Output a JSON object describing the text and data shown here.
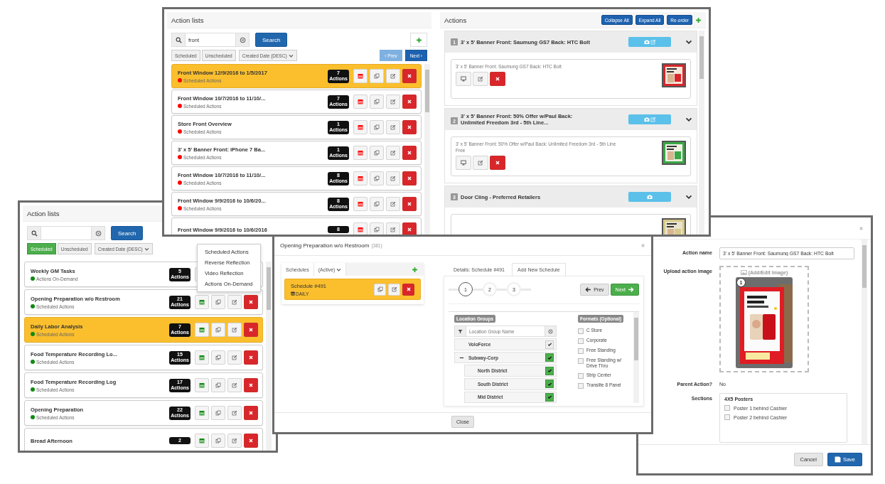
{
  "top_window": {
    "action_lists": {
      "title": "Action lists",
      "search": {
        "value": "front"
      },
      "search_button": "Search",
      "filters": [
        {
          "label": "Scheduled",
          "selected": false
        },
        {
          "label": "Unscheduled",
          "selected": false
        }
      ],
      "sort": "Created Date (DESC)",
      "pager": [
        {
          "label": "‹ Prev",
          "disabled": true
        },
        {
          "label": "Next ›",
          "disabled": false
        }
      ],
      "rows": [
        {
          "title": "Front Window 12/9/2016 to 1/5/2017",
          "status": "Scheduled Actions",
          "color": "#ff0000",
          "count": "7",
          "count_label": "Actions",
          "selected": true
        },
        {
          "title": "Front Window 10/7/2016 to 11/10/...",
          "status": "Scheduled Actions",
          "color": "#ff0000",
          "count": "7",
          "count_label": "Actions",
          "selected": false
        },
        {
          "title": "Store Front Overview",
          "status": "Scheduled Actions",
          "color": "#ff0000",
          "count": "1",
          "count_label": "Actions",
          "selected": false
        },
        {
          "title": "3' x 5' Banner Front: iPhone 7 Ba...",
          "status": "Scheduled Actions",
          "color": "#ff0000",
          "count": "1",
          "count_label": "Actions",
          "selected": false
        },
        {
          "title": "Front Window 10/7/2016 to 11/10/...",
          "status": "Scheduled Actions",
          "color": "#ff0000",
          "count": "8",
          "count_label": "Actions",
          "selected": false
        },
        {
          "title": "Front Window 9/9/2016 to 10/6/20...",
          "status": "Scheduled Actions",
          "color": "#ff0000",
          "count": "8",
          "count_label": "Actions",
          "selected": false
        },
        {
          "title": "Front Window 9/9/2016 to 10/6/2016",
          "color": "#ff0000",
          "count": "8",
          "selected": false
        }
      ]
    },
    "actions": {
      "title": "Actions",
      "buttons": [
        "Collapse All",
        "Expand All",
        "Re-order"
      ],
      "items": [
        {
          "number": "1",
          "title": "3' x 5' Banner Front: Saumung GS7 Back: HTC Bolt",
          "has_edit_image": true,
          "detail": "3' x 5' Banner Front: Saumung GS7 Back: HTC Bolt"
        },
        {
          "number": "2",
          "title": "3' x 5' Banner Front: 50% Offer w/Paul Back: Unlimited Freedom 3rd - 5th Line...",
          "has_edit_image": true,
          "detail": "3' x 5' Banner Front: 50% Offer w/Paul Back: Unlimited Freedom 3rd - 5th Line Free"
        },
        {
          "number": "3",
          "title": "Door Cling - Preferred Retailers",
          "has_edit_image": false
        }
      ]
    }
  },
  "left_window": {
    "title": "Action lists",
    "search_button": "Search",
    "filters": [
      {
        "label": "Scheduled",
        "selected": true
      },
      {
        "label": "Unscheduled",
        "selected": false
      }
    ],
    "sort": "Created Date (DESC)",
    "menu": [
      "Scheduled Actions",
      "Reverse Reflection",
      "Video Reflection",
      "Actions On-Demand"
    ],
    "rows": [
      {
        "title": "Weekly GM Tasks",
        "status": "Actions On-Demand",
        "color": "#118a11",
        "count": "5",
        "count_label": "Actions",
        "selected": false
      },
      {
        "title": "Opening Preparation w/o Restroom",
        "status": "Scheduled Actions",
        "color": "#118a11",
        "count": "21",
        "count_label": "Actions",
        "selected": false
      },
      {
        "title": "Daily Labor Analysis",
        "status": "Scheduled Actions",
        "color": "#118a11",
        "count": "7",
        "count_label": "Actions",
        "selected": true
      },
      {
        "title": "Food Temperature Recording Lo...",
        "status": "Scheduled Actions",
        "color": "#118a11",
        "count": "15",
        "count_label": "Actions",
        "selected": false
      },
      {
        "title": "Food Temperature Recording Log",
        "status": "Scheduled Actions",
        "color": "#118a11",
        "count": "17",
        "count_label": "Actions",
        "selected": false
      },
      {
        "title": "Opening Preparation",
        "status": "Scheduled Actions",
        "color": "#118a11",
        "count": "22",
        "count_label": "Actions",
        "selected": false
      },
      {
        "title": "Bread Afternoon",
        "color": "#118a11",
        "count": "2",
        "selected": false
      }
    ]
  },
  "schedule_dialog": {
    "title": "Opening Preparation w/o Restroom",
    "count": "(381)",
    "schedules_label": "Schedules",
    "schedule_filter": "(Active)",
    "schedules": [
      {
        "name": "Schedule #491",
        "frequency": "DAILY",
        "selected": true
      }
    ],
    "tabs": [
      {
        "label": "Details: Schedule #491",
        "selected": false
      },
      {
        "label": "Add New Schedule",
        "selected": true
      }
    ],
    "steps": [
      {
        "label": "1",
        "selected": true
      },
      {
        "label": "2",
        "selected": false
      },
      {
        "label": "3",
        "selected": false
      }
    ],
    "prev": "Prev",
    "next": "Next",
    "location_groups": {
      "title": "Location Groups",
      "placeholder": "Location Group Name",
      "tree": [
        {
          "name": "VoloForce",
          "checked": true,
          "partial": true
        },
        {
          "name": "Subway-Corp",
          "checked": true,
          "partial": false,
          "expanded": true,
          "children": [
            {
              "name": "North District",
              "checked": true,
              "partial": false
            },
            {
              "name": "South District",
              "checked": true,
              "partial": false
            },
            {
              "name": "Mid District",
              "checked": true,
              "partial": false
            }
          ]
        }
      ]
    },
    "formats": {
      "title": "Formats (Optional)",
      "items": [
        {
          "label": "C Store",
          "checked": false
        },
        {
          "label": "Corporate",
          "checked": false
        },
        {
          "label": "Free Standing",
          "checked": false
        },
        {
          "label": "Free Standing w/ Drive Thru",
          "checked": false
        },
        {
          "label": "Strip Center",
          "checked": false
        },
        {
          "label": "Transilte 8 Panel",
          "checked": false
        }
      ]
    },
    "close": "Close"
  },
  "edit_action_dialog": {
    "action_name_label": "Action name",
    "action_name": "3' x 5' Banner Front: Saumung GS7 Back: HTC Bolt",
    "upload_label": "Upload action image",
    "add_image": "(Add/Edit Image)",
    "image_number": "1",
    "parent_label": "Parent Action?",
    "parent_value": "No",
    "sections_label": "Sections",
    "section_group": "4X5 Posters",
    "sections": [
      {
        "label": "Poster 1 behind Cashier",
        "checked": false
      },
      {
        "label": "Poster 2 behind Cashier",
        "checked": false
      }
    ],
    "cancel": "Cancel",
    "save": "Save"
  }
}
